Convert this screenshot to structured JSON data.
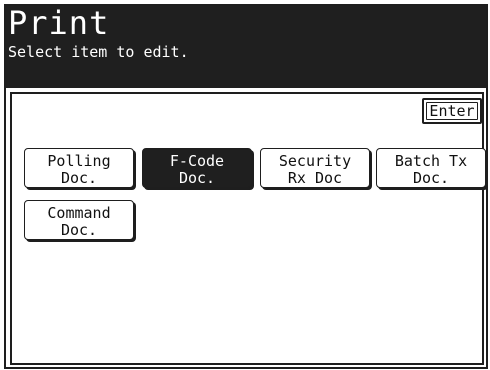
{
  "header": {
    "title": "Print",
    "subtitle": "Select item to edit."
  },
  "enter_label": "Enter",
  "items": [
    {
      "line1": "Polling",
      "line2": "Doc.",
      "selected": false
    },
    {
      "line1": "F-Code",
      "line2": "Doc.",
      "selected": true
    },
    {
      "line1": "Security",
      "line2": "Rx Doc",
      "selected": false
    },
    {
      "line1": "Batch Tx",
      "line2": "Doc.",
      "selected": false
    },
    {
      "line1": "Command",
      "line2": "Doc.",
      "selected": false
    }
  ],
  "colors": {
    "header_bg": "#1f1f1f",
    "header_text": "#ffffff",
    "border": "#1e1e1e",
    "selected_bg": "#1f1f1f"
  }
}
